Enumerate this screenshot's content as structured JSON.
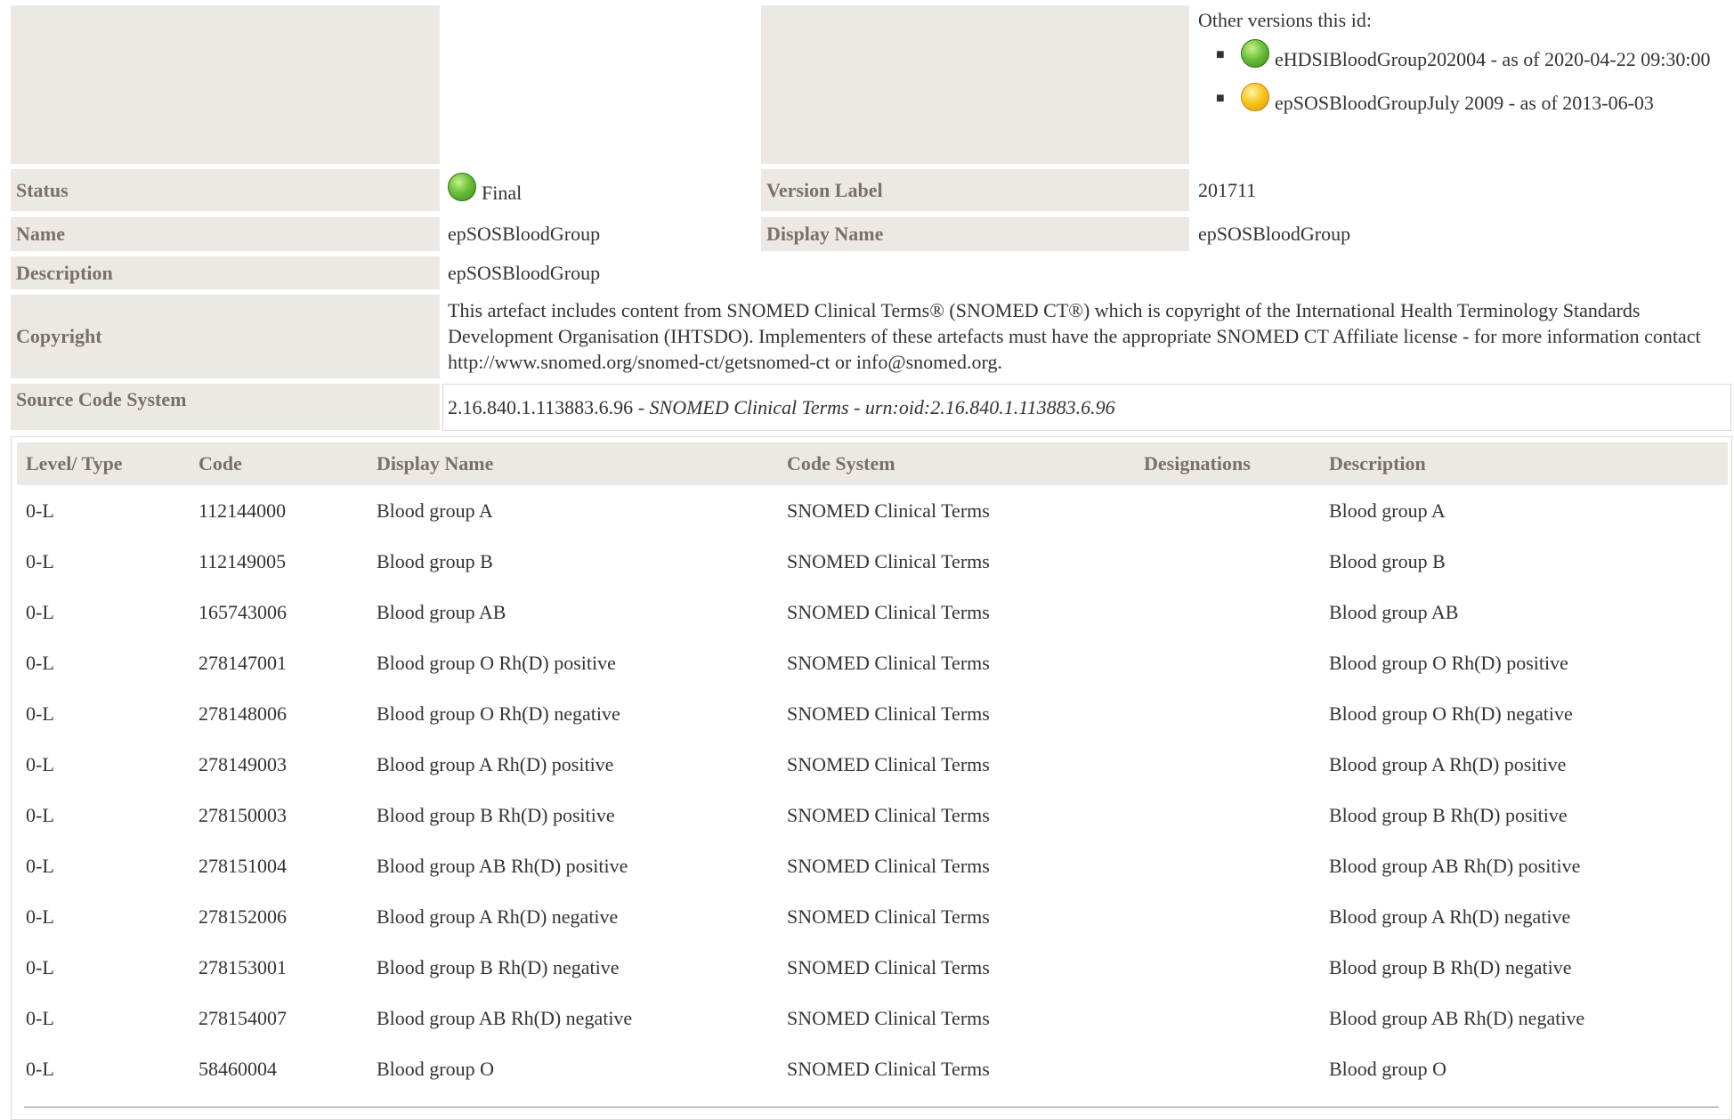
{
  "header": {
    "other_versions_label": "Other versions this id:",
    "other_versions": [
      {
        "icon": "green-status-dot",
        "label": "eHDSIBloodGroup202004 - as of 2020-04-22 09:30:00"
      },
      {
        "icon": "yellow-status-dot",
        "label": "epSOSBloodGroupJuly 2009 - as of 2013-06-03"
      }
    ]
  },
  "meta": {
    "status_label": "Status",
    "status_value": "Final",
    "version_label": "Version Label",
    "version_value": "201711",
    "name_label": "Name",
    "name_value": "epSOSBloodGroup",
    "display_name_label": "Display Name",
    "display_name_value": "epSOSBloodGroup",
    "description_label": "Description",
    "description_value": "epSOSBloodGroup",
    "copyright_label": "Copyright",
    "copyright_value": "This artefact includes content from SNOMED Clinical Terms® (SNOMED CT®) which is copyright of the International Health Terminology Standards Development Organisation (IHTSDO). Implementers of these artefacts must have the appropriate SNOMED CT Affiliate license - for more information contact http://www.snomed.org/snomed-ct/getsnomed-ct or info@snomed.org.",
    "source_label": "Source Code System",
    "source_oid": "2.16.840.1.113883.6.96",
    "source_sep": " - ",
    "source_name": "SNOMED Clinical Terms - urn:oid:2.16.840.1.113883.6.96"
  },
  "table": {
    "columns": [
      "Level/ Type",
      "Code",
      "Display Name",
      "Code System",
      "Designations",
      "Description"
    ],
    "rows": [
      [
        "0-L",
        "112144000",
        "Blood group A",
        "SNOMED Clinical Terms",
        "",
        "Blood group A"
      ],
      [
        "0-L",
        "112149005",
        "Blood group B",
        "SNOMED Clinical Terms",
        "",
        "Blood group B"
      ],
      [
        "0-L",
        "165743006",
        "Blood group AB",
        "SNOMED Clinical Terms",
        "",
        "Blood group AB"
      ],
      [
        "0-L",
        "278147001",
        "Blood group O Rh(D) positive",
        "SNOMED Clinical Terms",
        "",
        "Blood group O Rh(D) positive"
      ],
      [
        "0-L",
        "278148006",
        "Blood group O Rh(D) negative",
        "SNOMED Clinical Terms",
        "",
        "Blood group O Rh(D) negative"
      ],
      [
        "0-L",
        "278149003",
        "Blood group A Rh(D) positive",
        "SNOMED Clinical Terms",
        "",
        "Blood group A Rh(D) positive"
      ],
      [
        "0-L",
        "278150003",
        "Blood group B Rh(D) positive",
        "SNOMED Clinical Terms",
        "",
        "Blood group B Rh(D) positive"
      ],
      [
        "0-L",
        "278151004",
        "Blood group AB Rh(D) positive",
        "SNOMED Clinical Terms",
        "",
        "Blood group AB Rh(D) positive"
      ],
      [
        "0-L",
        "278152006",
        "Blood group A Rh(D) negative",
        "SNOMED Clinical Terms",
        "",
        "Blood group A Rh(D) negative"
      ],
      [
        "0-L",
        "278153001",
        "Blood group B Rh(D) negative",
        "SNOMED Clinical Terms",
        "",
        "Blood group B Rh(D) negative"
      ],
      [
        "0-L",
        "278154007",
        "Blood group AB Rh(D) negative",
        "SNOMED Clinical Terms",
        "",
        "Blood group AB Rh(D) negative"
      ],
      [
        "0-L",
        "58460004",
        "Blood group O",
        "SNOMED Clinical Terms",
        "",
        "Blood group O"
      ]
    ]
  }
}
